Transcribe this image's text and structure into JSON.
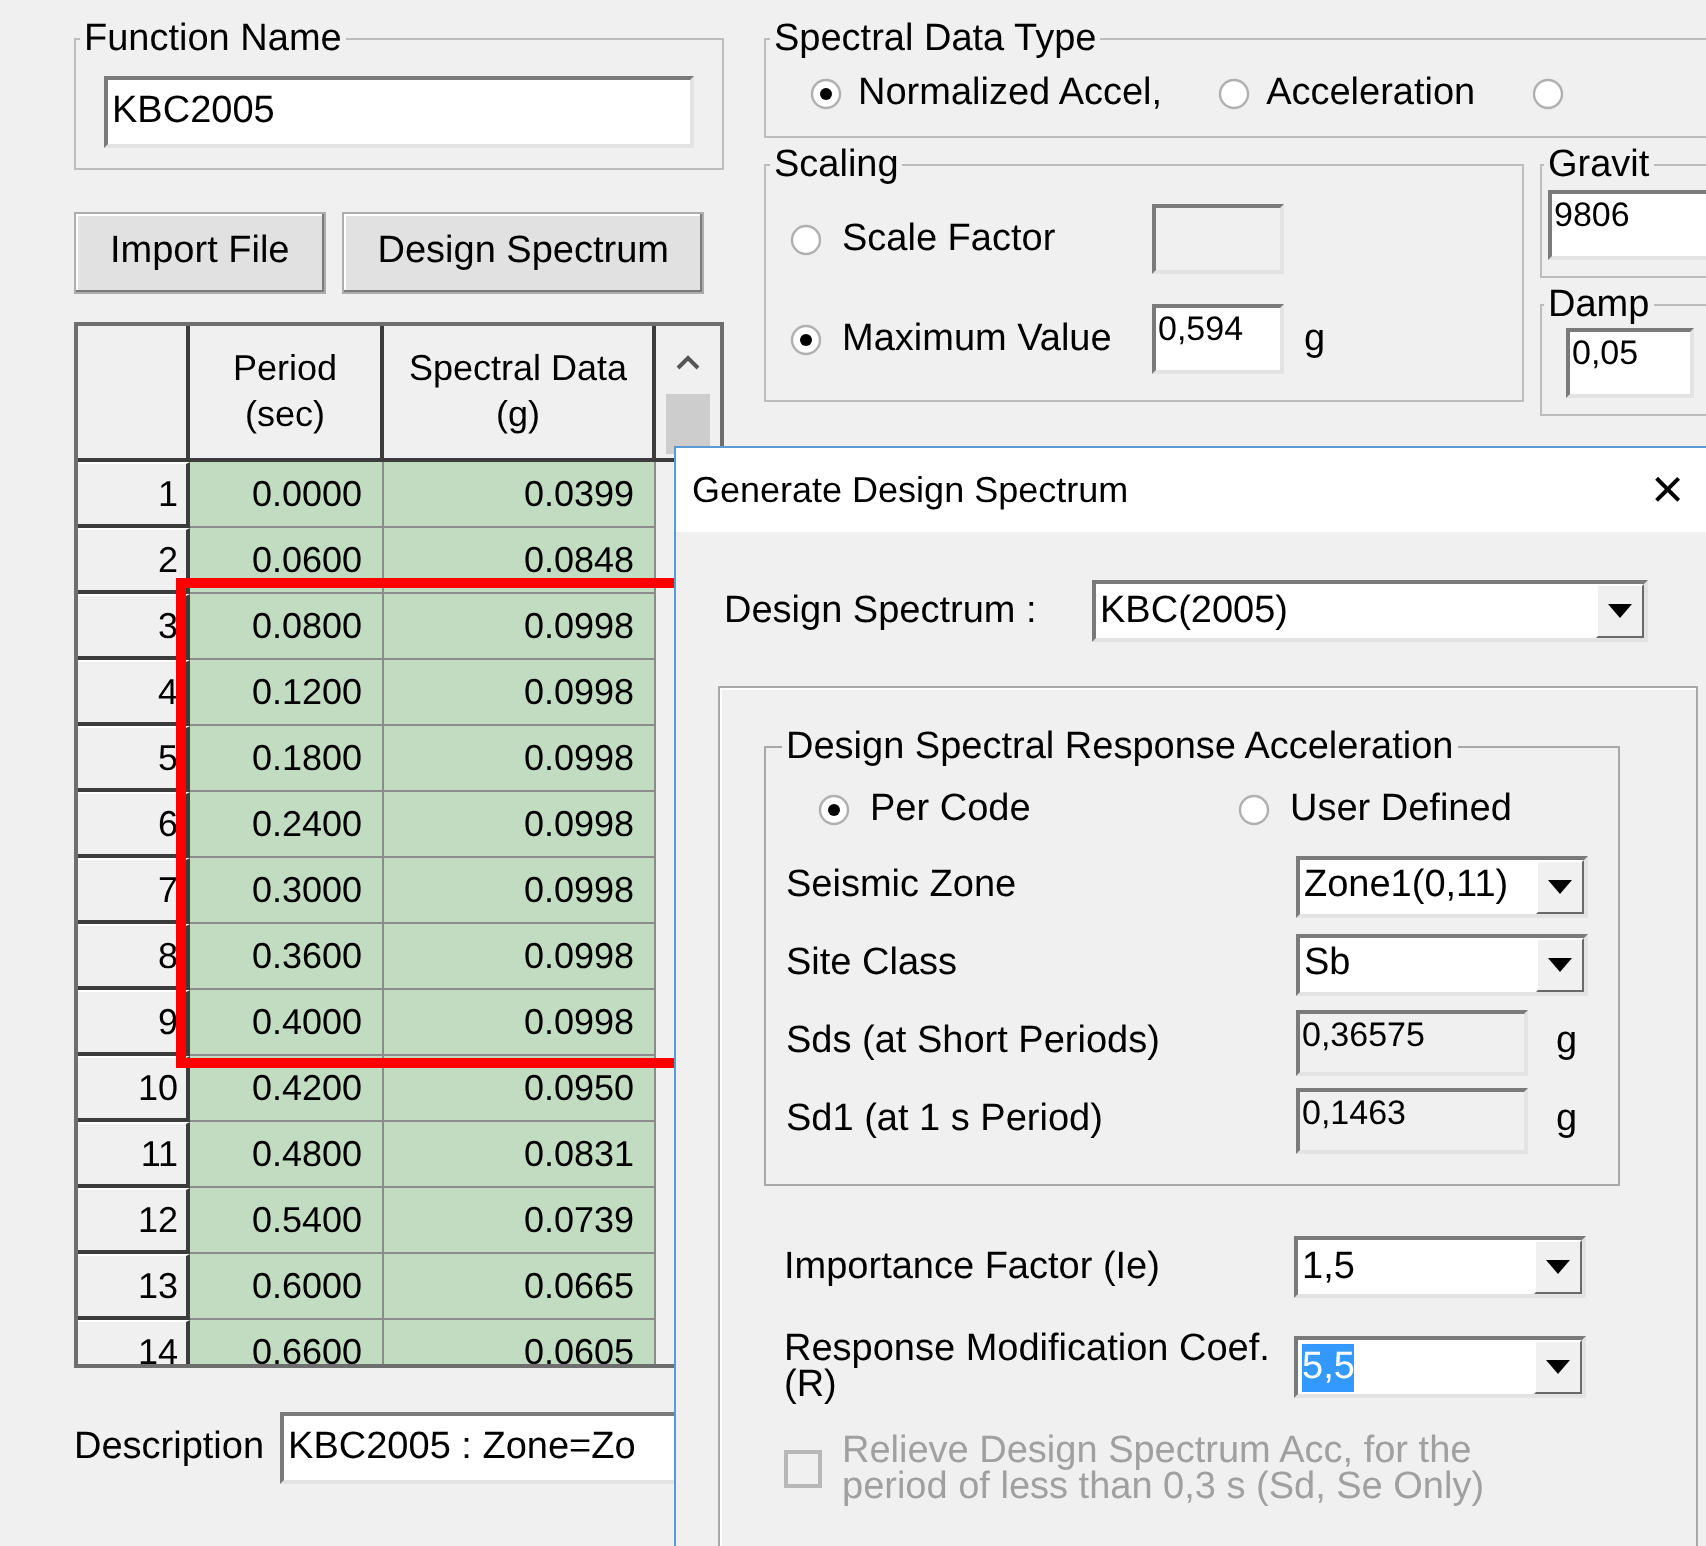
{
  "function_name": {
    "title": "Function Name",
    "value": "KBC2005"
  },
  "spectral_data_type": {
    "title": "Spectral Data Type",
    "options": [
      {
        "label": "Normalized Accel,",
        "selected": true
      },
      {
        "label": "Acceleration",
        "selected": false
      },
      {
        "selected": false
      }
    ]
  },
  "buttons": [
    "Import File",
    "Design Spectrum"
  ],
  "scaling": {
    "title": "Scaling",
    "options": [
      {
        "label": "Scale Factor",
        "selected": false
      },
      {
        "label": "Maximum Value",
        "selected": true,
        "value": "0,594",
        "unit": "g"
      }
    ]
  },
  "gravity": {
    "title": "Gravit",
    "value": "9806"
  },
  "damping": {
    "title": "Damp",
    "value": "0,05"
  },
  "table": {
    "columns": [
      [
        "Period",
        "(sec)"
      ],
      [
        "Spectral Data",
        "(g)"
      ]
    ],
    "rows": [
      {
        "index": "1",
        "period": "0.0000",
        "value": "0.0399"
      },
      {
        "index": "2",
        "period": "0.0600",
        "value": "0.0848"
      },
      {
        "index": "3",
        "period": "0.0800",
        "value": "0.0998"
      },
      {
        "index": "4",
        "period": "0.1200",
        "value": "0.0998"
      },
      {
        "index": "5",
        "period": "0.1800",
        "value": "0.0998"
      },
      {
        "index": "6",
        "period": "0.2400",
        "value": "0.0998"
      },
      {
        "index": "7",
        "period": "0.3000",
        "value": "0.0998"
      },
      {
        "index": "8",
        "period": "0.3600",
        "value": "0.0998"
      },
      {
        "index": "9",
        "period": "0.4000",
        "value": "0.0998"
      },
      {
        "index": "10",
        "period": "0.4200",
        "value": "0.0950"
      },
      {
        "index": "11",
        "period": "0.4800",
        "value": "0.0831"
      },
      {
        "index": "12",
        "period": "0.5400",
        "value": "0.0739"
      },
      {
        "index": "13",
        "period": "0.6000",
        "value": "0.0665"
      },
      {
        "index": "14",
        "period": "0.6600",
        "value": "0.0605"
      }
    ]
  },
  "description": {
    "label": "Description",
    "value": "KBC2005 : Zone=Zo"
  },
  "dialog": {
    "title": "Generate Design Spectrum",
    "close": "×",
    "design_spectrum": {
      "label": "Design Spectrum :",
      "value": "KBC(2005)"
    },
    "group": {
      "title": "Design Spectral Response Acceleration",
      "modes": [
        {
          "label": "Per Code",
          "selected": true
        },
        {
          "label": "User Defined",
          "selected": false
        }
      ],
      "rows": [
        {
          "kind": "combo",
          "label": "Seismic Zone",
          "value": "Zone1(0,11)"
        },
        {
          "kind": "combo",
          "label": "Site Class",
          "value": "Sb"
        },
        {
          "kind": "readonly",
          "label": "Sds (at Short Periods)",
          "value": "0,36575",
          "unit": "g"
        },
        {
          "kind": "readonly",
          "label": "Sd1 (at 1 s Period)",
          "value": "0,1463",
          "unit": "g"
        }
      ]
    },
    "rows": [
      {
        "label": "Importance Factor (Ie)",
        "value": "1,5",
        "selected": false
      },
      {
        "label": "Response Modification Coef. (R)",
        "value": "5,5",
        "selected": true
      }
    ],
    "checkbox": {
      "label": "Relieve Design Spectrum Acc, for the period of less than 0,3 s (Sd, Se Only)",
      "checked": false,
      "disabled": true
    }
  }
}
